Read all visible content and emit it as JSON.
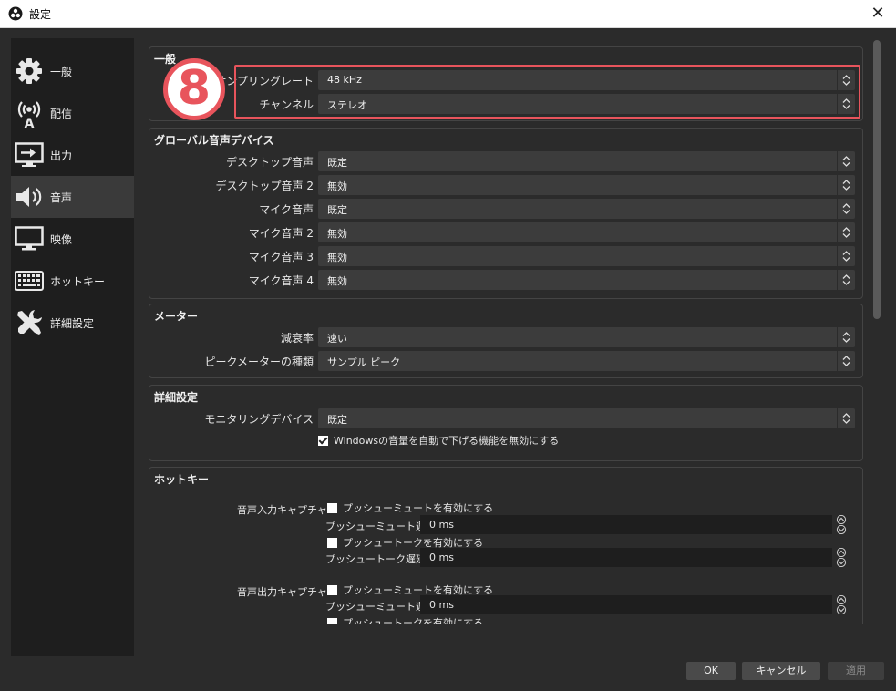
{
  "window": {
    "title": "設定",
    "close_glyph": "✕"
  },
  "sidebar": {
    "items": [
      {
        "label": "一般",
        "icon": "gear-icon"
      },
      {
        "label": "配信",
        "icon": "broadcast-icon"
      },
      {
        "label": "出力",
        "icon": "output-icon"
      },
      {
        "label": "音声",
        "icon": "speaker-icon",
        "active": true
      },
      {
        "label": "映像",
        "icon": "monitor-icon"
      },
      {
        "label": "ホットキー",
        "icon": "keyboard-icon"
      },
      {
        "label": "詳細設定",
        "icon": "tools-icon"
      }
    ]
  },
  "general": {
    "title": "一般",
    "sample_rate_label": "サンプリングレート",
    "sample_rate_value": "48 kHz",
    "channels_label": "チャンネル",
    "channels_value": "ステレオ"
  },
  "global_audio": {
    "title": "グローバル音声デバイス",
    "rows": [
      {
        "label": "デスクトップ音声",
        "value": "既定"
      },
      {
        "label": "デスクトップ音声 2",
        "value": "無効"
      },
      {
        "label": "マイク音声",
        "value": "既定"
      },
      {
        "label": "マイク音声 2",
        "value": "無効"
      },
      {
        "label": "マイク音声 3",
        "value": "無効"
      },
      {
        "label": "マイク音声 4",
        "value": "無効"
      }
    ]
  },
  "meters": {
    "title": "メーター",
    "decay_label": "減衰率",
    "decay_value": "速い",
    "peak_type_label": "ピークメーターの種類",
    "peak_type_value": "サンプル ピーク"
  },
  "advanced": {
    "title": "詳細設定",
    "monitoring_label": "モニタリングデバイス",
    "monitoring_value": "既定",
    "ducking_label": "Windowsの音量を自動で下げる機能を無効にする",
    "ducking_checked": true
  },
  "hotkeys": {
    "title": "ホットキー",
    "capture_in_label": "音声入力キャプチャ",
    "capture_out_label": "音声出力キャプチャ",
    "push_mute_enable": "プッシューミュートを有効にする",
    "push_mute_delay_label": "プッシューミュート遅延",
    "push_mute_delay_value": "0 ms",
    "push_talk_enable": "プッシュートークを有効にする",
    "push_talk_delay_label": "プッシュートーク遅延",
    "push_talk_delay_value": "0 ms"
  },
  "annotation": {
    "number": "8",
    "color": "#e8545c"
  },
  "buttons": {
    "ok": "OK",
    "cancel": "キャンセル",
    "apply": "適用"
  }
}
